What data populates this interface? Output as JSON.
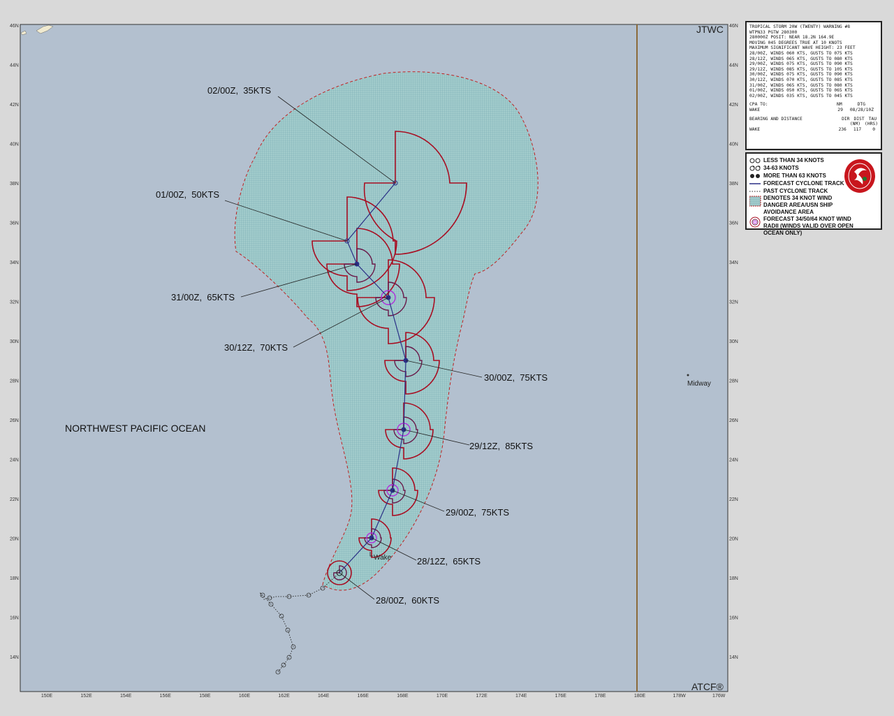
{
  "title_mark": "JTWC",
  "footer_mark": "ATCF®",
  "region_label": "NORTHWEST PACIFIC OCEAN",
  "places": [
    {
      "name": "Midway"
    },
    {
      "name": "Wake"
    }
  ],
  "lon_ticks": [
    "150E",
    "152E",
    "154E",
    "156E",
    "158E",
    "160E",
    "162E",
    "164E",
    "166E",
    "168E",
    "170E",
    "172E",
    "174E",
    "176E",
    "178E",
    "180E",
    "178W",
    "176W"
  ],
  "lat_ticks": [
    "46N",
    "44N",
    "42N",
    "40N",
    "38N",
    "36N",
    "34N",
    "32N",
    "30N",
    "28N",
    "26N",
    "24N",
    "22N",
    "20N",
    "18N",
    "16N",
    "14N"
  ],
  "forecast_labels": [
    {
      "text": "02/00Z,  35KTS"
    },
    {
      "text": "01/00Z,  50KTS"
    },
    {
      "text": "31/00Z,  65KTS"
    },
    {
      "text": "30/12Z,  70KTS"
    },
    {
      "text": "30/00Z,  75KTS"
    },
    {
      "text": "29/12Z,  85KTS"
    },
    {
      "text": "29/00Z,  75KTS"
    },
    {
      "text": "28/12Z,  65KTS"
    },
    {
      "text": "28/00Z,  60KTS"
    }
  ],
  "info_box": {
    "header_lines": [
      "TROPICAL STORM 20W (TWENTY) WARNING #8",
      "WTPN33 PGTW 280300",
      "280000Z POSIT: NEAR 18.2N 164.9E",
      "MOVING 045 DEGREES TRUE AT 10 KNOTS",
      "MAXIMUM SIGNIFICANT WAVE HEIGHT: 23 FEET",
      "28/00Z, WINDS 060 KTS, GUSTS TO 075 KTS",
      "28/12Z, WINDS 065 KTS, GUSTS TO 080 KTS",
      "29/00Z, WINDS 075 KTS, GUSTS TO 090 KTS",
      "29/12Z, WINDS 085 KTS, GUSTS TO 105 KTS",
      "30/00Z, WINDS 075 KTS, GUSTS TO 090 KTS",
      "30/12Z, WINDS 070 KTS, GUSTS TO 085 KTS",
      "31/00Z, WINDS 065 KTS, GUSTS TO 080 KTS",
      "01/00Z, WINDS 050 KTS, GUSTS TO 065 KTS",
      "02/00Z, WINDS 035 KTS, GUSTS TO 045 KTS"
    ],
    "cpa_header": [
      "CPA TO:",
      "NM",
      "DTG"
    ],
    "cpa_row": [
      "WAKE",
      "29",
      "08/28/10Z"
    ],
    "bearing_header": [
      "BEARING AND DISTANCE",
      "DIR",
      "DIST",
      "TAU"
    ],
    "bearing_units": [
      "",
      "",
      "(NM)",
      "(HRS)"
    ],
    "bearing_row": [
      "WAKE",
      "236",
      "117",
      "0"
    ]
  },
  "legend": {
    "items": [
      {
        "label": "LESS THAN 34 KNOTS",
        "icon": "circle-open-icon"
      },
      {
        "label": "34-63 KNOTS",
        "icon": "storm-symbol-open-icon"
      },
      {
        "label": "MORE THAN 63 KNOTS",
        "icon": "storm-symbol-filled-icon"
      },
      {
        "label": "FORECAST CYCLONE TRACK",
        "icon": "solid-line-icon"
      },
      {
        "label": "PAST CYCLONE TRACK",
        "icon": "dotted-line-icon"
      },
      {
        "label": "DENOTES 34 KNOT WIND DANGER AREA/USN SHIP AVOIDANCE AREA",
        "icon": "hatched-area-icon"
      },
      {
        "label": "FORECAST 34/50/64 KNOT WIND RADII (WINDS VALID OVER OPEN OCEAN ONLY)",
        "icon": "wind-radii-icon"
      }
    ]
  },
  "colors": {
    "ocean": "#b3c0cf",
    "danger_area": "#9fc6c6",
    "radii_34": "#a80e22",
    "radii_50": "#6a1a4a",
    "radii_64": "#b02fdc",
    "track": "#2a2f86",
    "dateline": "#8b6a3a"
  }
}
